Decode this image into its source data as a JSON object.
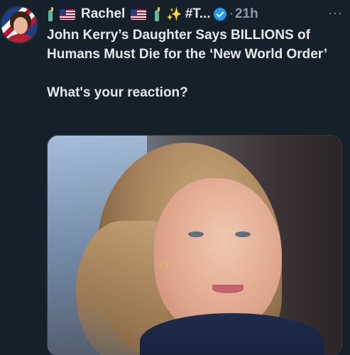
{
  "author": {
    "name": "Rachel",
    "prefix_icons": [
      "statue-of-liberty-icon",
      "us-flag-icon"
    ],
    "suffix_icons": [
      "us-flag-icon",
      "statue-of-liberty-icon",
      "sparkles-icon"
    ],
    "handle_truncated": "#T...",
    "verified": true,
    "separator": "·",
    "timestamp": "21h"
  },
  "more_label": "···",
  "tweet": {
    "headline": "John Kerry’s Daughter Says BILLIONS of Humans Must Die for the ‘New World Order’",
    "question": "What's your reaction?"
  },
  "colors": {
    "background": "#15202b",
    "text": "#e7e9ea",
    "muted": "#8b98a5",
    "verified": "#1d9bf0"
  },
  "media": {
    "type": "photo",
    "subject": "woman-portrait"
  }
}
